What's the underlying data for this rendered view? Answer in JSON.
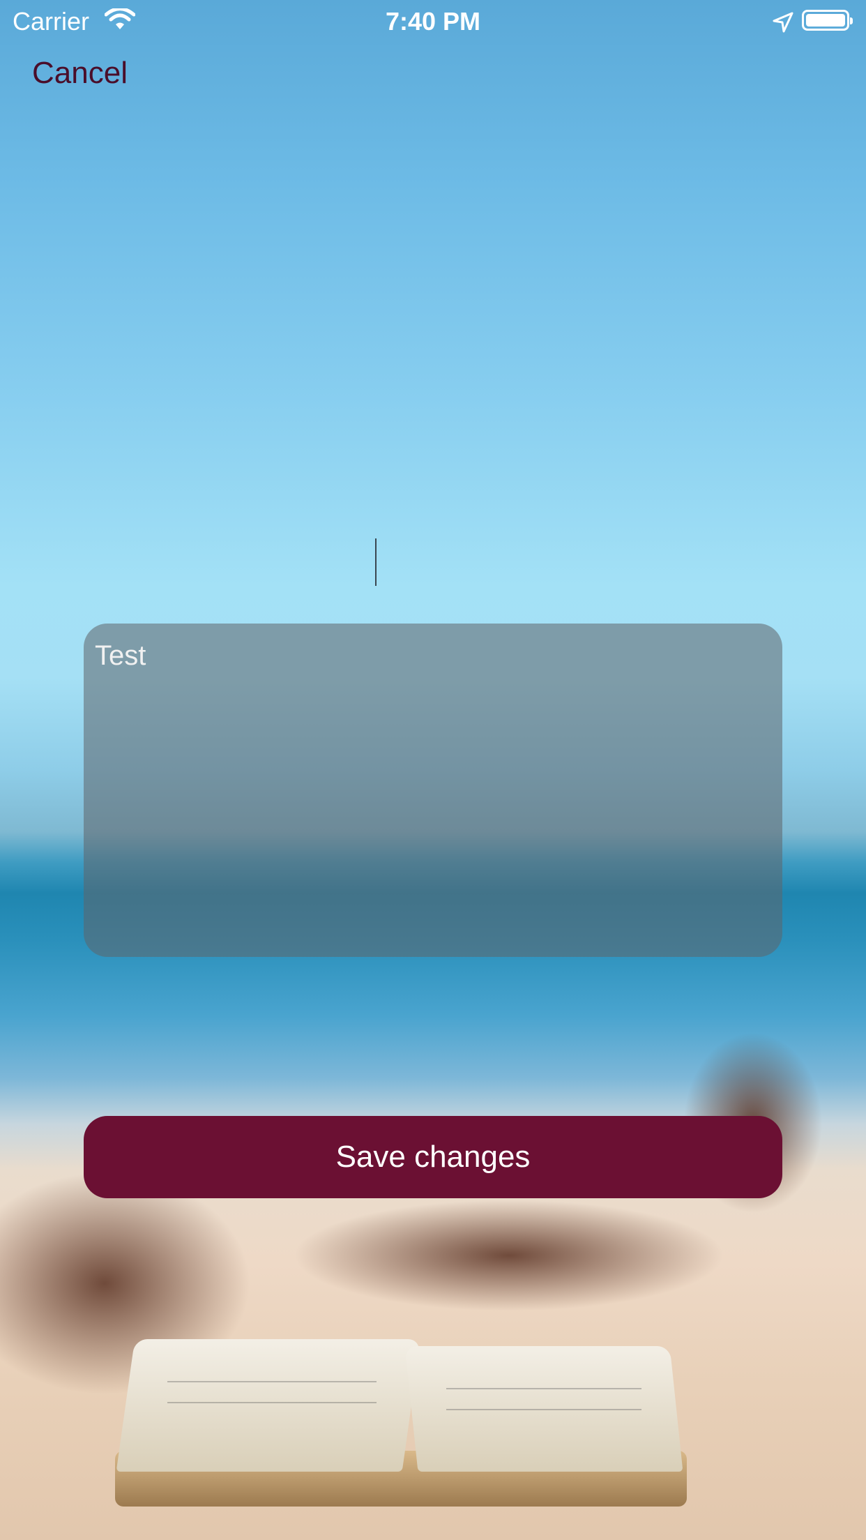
{
  "status_bar": {
    "carrier": "Carrier",
    "time": "7:40 PM"
  },
  "nav": {
    "cancel_label": "Cancel"
  },
  "editor": {
    "text": "Test"
  },
  "actions": {
    "save_label": "Save changes"
  },
  "colors": {
    "accent": "#6b1033",
    "cancel_text": "#4a0e2a"
  },
  "icons": [
    "wifi-icon",
    "location-arrow-icon",
    "battery-icon"
  ]
}
